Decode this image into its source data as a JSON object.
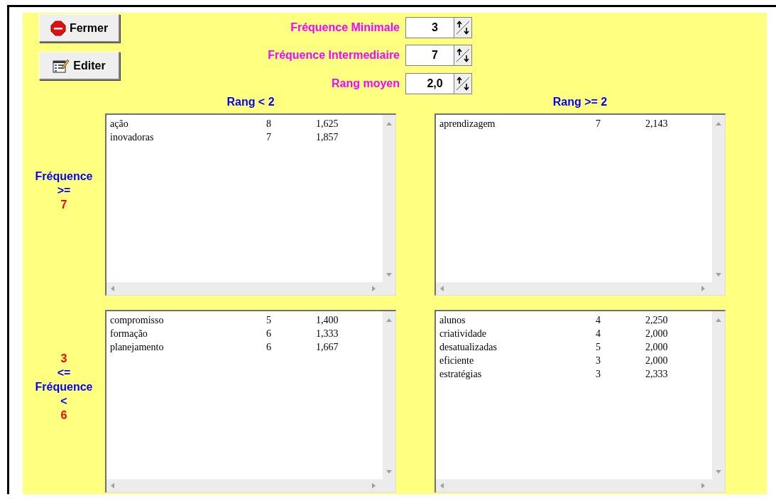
{
  "buttons": [
    {
      "label": "Fermer",
      "kind": "stop"
    },
    {
      "label": "Editer",
      "kind": "edit"
    }
  ],
  "spinners": [
    {
      "label": "Fréquence Minimale",
      "value": "3"
    },
    {
      "label": "Fréquence Intermediaire",
      "value": "7"
    },
    {
      "label": "Rang moyen",
      "value": "2,0"
    }
  ],
  "column_headers": [
    "Rang < 2",
    "Rang >= 2"
  ],
  "rows": [
    {
      "label": [
        {
          "text": "Fréquence",
          "kind": "word"
        },
        {
          "text": ">=",
          "kind": "word"
        },
        {
          "text": "7",
          "kind": "number"
        }
      ],
      "lists": [
        {
          "items": [
            {
              "word": "ação",
              "count": "8",
              "rank": "1,625"
            },
            {
              "word": "inovadoras",
              "count": "7",
              "rank": "1,857"
            }
          ]
        },
        {
          "items": [
            {
              "word": "aprendizagem",
              "count": "7",
              "rank": "2,143"
            }
          ]
        }
      ]
    },
    {
      "label": [
        {
          "text": "3",
          "kind": "number"
        },
        {
          "text": "<=",
          "kind": "word"
        },
        {
          "text": "Fréquence",
          "kind": "word"
        },
        {
          "text": "<",
          "kind": "word"
        },
        {
          "text": "6",
          "kind": "number"
        }
      ],
      "lists": [
        {
          "items": [
            {
              "word": "compromisso",
              "count": "5",
              "rank": "1,400"
            },
            {
              "word": "formação",
              "count": "6",
              "rank": "1,333"
            },
            {
              "word": "planejamento",
              "count": "6",
              "rank": "1,667"
            }
          ]
        },
        {
          "items": [
            {
              "word": "alunos",
              "count": "4",
              "rank": "2,250"
            },
            {
              "word": "criatividade",
              "count": "4",
              "rank": "2,000"
            },
            {
              "word": "desatualizadas",
              "count": "5",
              "rank": "2,000"
            },
            {
              "word": "eficiente",
              "count": "3",
              "rank": "2,000"
            },
            {
              "word": "estratégias",
              "count": "3",
              "rank": "2,333"
            }
          ]
        }
      ]
    }
  ]
}
